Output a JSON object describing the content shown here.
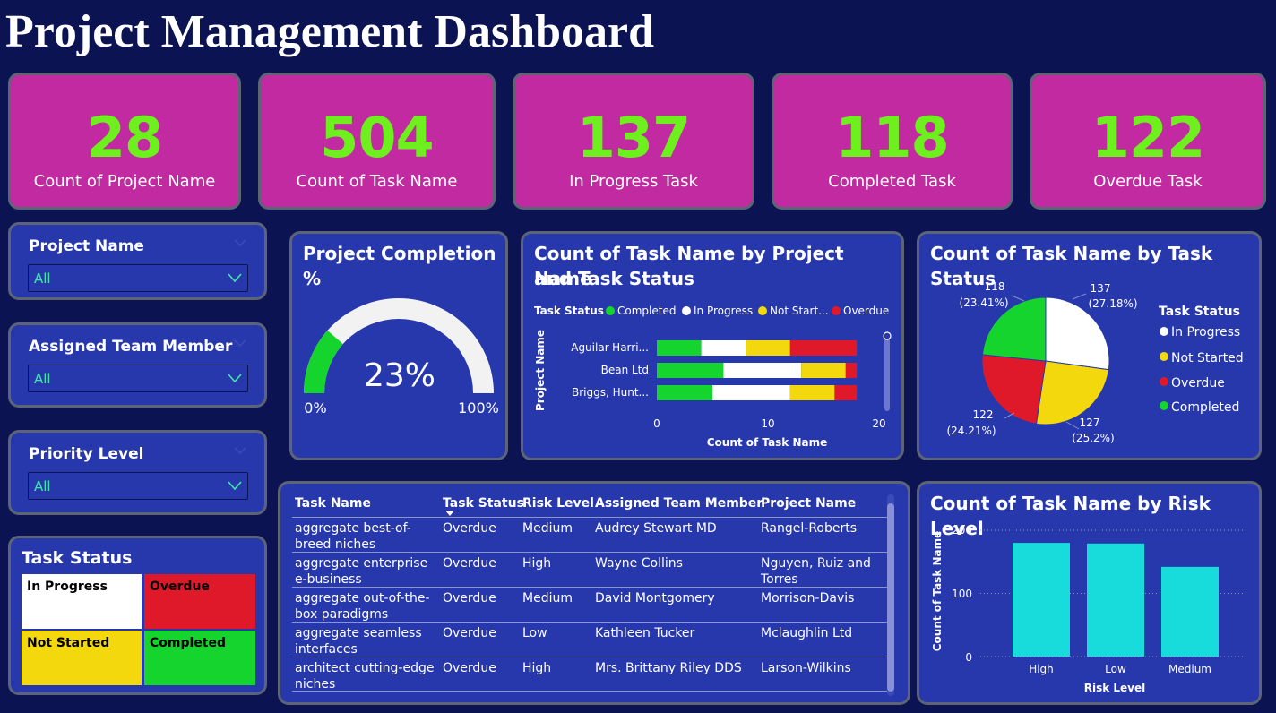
{
  "title": "Project Management Dashboard",
  "colors": {
    "background": "#0b1352",
    "card": "#2738ad",
    "kpi_card": "#c12aa0",
    "kpi_value": "#6ef01e",
    "completed": "#16d42e",
    "in_progress": "#ffffff",
    "not_started": "#f2d80c",
    "overdue": "#e0192a",
    "bar": "#18dcdc"
  },
  "kpis": [
    {
      "value": "28",
      "label": "Count of Project Name"
    },
    {
      "value": "504",
      "label": "Count of Task Name"
    },
    {
      "value": "137",
      "label": "In Progress Task"
    },
    {
      "value": "118",
      "label": "Completed Task"
    },
    {
      "value": "122",
      "label": "Overdue Task"
    }
  ],
  "slicers": [
    {
      "title": "Project Name",
      "value": "All",
      "icon": "chevron-down-icon"
    },
    {
      "title": "Assigned Team Member",
      "value": "All",
      "icon": "chevron-down-icon"
    },
    {
      "title": "Priority Level",
      "value": "All",
      "icon": "chevron-down-icon"
    }
  ],
  "task_status_legend": {
    "title": "Task Status",
    "cells": [
      "In Progress",
      "Overdue",
      "Not Started",
      "Completed"
    ]
  },
  "gauge": {
    "title": "Project Completion %",
    "value_label": "23%",
    "value_fraction": 0.23,
    "min_label": "0%",
    "max_label": "100%"
  },
  "stacked_chart": {
    "title_line1": "Count of Task Name by Project Name",
    "title_line2": "and Task Status",
    "legend_title": "Task Status",
    "legend": [
      "Completed",
      "In Progress",
      "Not Start...",
      "Overdue"
    ],
    "ylabel": "Project Name",
    "xlabel": "Count of Task Name",
    "xticks": [
      "0",
      "10",
      "20"
    ]
  },
  "pie_chart": {
    "title": "Count of Task Name by Task Status",
    "legend_title": "Task Status",
    "legend": [
      "In Progress",
      "Not Started",
      "Overdue",
      "Completed"
    ],
    "labels": [
      {
        "count": "137",
        "pct": "(27.18%)"
      },
      {
        "count": "127",
        "pct": "(25.2%)"
      },
      {
        "count": "122",
        "pct": "(24.21%)"
      },
      {
        "count": "118",
        "pct": "(23.41%)"
      }
    ]
  },
  "bar_chart": {
    "title": "Count of Task Name by Risk Level",
    "ylabel": "Count of Task Name",
    "xlabel": "Risk Level",
    "yticks": [
      "200",
      "100",
      "0"
    ]
  },
  "table": {
    "headers": [
      "Task Name",
      "Task Status",
      "Risk Level",
      "Assigned Team Member",
      "Project Name"
    ],
    "rows": [
      {
        "task_l1": "aggregate best-of-",
        "task_l2": "breed niches",
        "status": "Overdue",
        "risk": "Medium",
        "member": "Audrey Stewart MD",
        "proj_l1": "Rangel-Roberts",
        "proj_l2": ""
      },
      {
        "task_l1": "aggregate enterprise",
        "task_l2": "e-business",
        "status": "Overdue",
        "risk": "High",
        "member": "Wayne Collins",
        "proj_l1": "Nguyen, Ruiz and",
        "proj_l2": "Torres"
      },
      {
        "task_l1": "aggregate out-of-the-",
        "task_l2": "box paradigms",
        "status": "Overdue",
        "risk": "Medium",
        "member": "David Montgomery",
        "proj_l1": "Morrison-Davis",
        "proj_l2": ""
      },
      {
        "task_l1": "aggregate seamless",
        "task_l2": "interfaces",
        "status": "Overdue",
        "risk": "Low",
        "member": "Kathleen Tucker",
        "proj_l1": "Mclaughlin Ltd",
        "proj_l2": ""
      },
      {
        "task_l1": "architect cutting-edge",
        "task_l2": "niches",
        "status": "Overdue",
        "risk": "High",
        "member": "Mrs. Brittany Riley DDS",
        "proj_l1": "Larson-Wilkins",
        "proj_l2": ""
      }
    ]
  },
  "chart_data": [
    {
      "type": "bar",
      "orientation": "horizontal",
      "stacked": true,
      "title": "Count of Task Name by Project Name and Task Status",
      "categories": [
        "Aguilar-Harri...",
        "Bean Ltd",
        "Briggs, Hunt..."
      ],
      "series": [
        {
          "name": "Completed",
          "values": [
            4,
            6,
            5
          ]
        },
        {
          "name": "In Progress",
          "values": [
            4,
            7,
            7
          ]
        },
        {
          "name": "Not Start...",
          "values": [
            4,
            4,
            4
          ]
        },
        {
          "name": "Overdue",
          "values": [
            6,
            1,
            2
          ]
        }
      ],
      "xlim": [
        0,
        20
      ],
      "xlabel": "Count of Task Name",
      "ylabel": "Project Name",
      "legend_title": "Task Status",
      "legend_position": "top"
    },
    {
      "type": "pie",
      "title": "Count of Task Name by Task Status",
      "categories": [
        "In Progress",
        "Not Started",
        "Overdue",
        "Completed"
      ],
      "values": [
        137,
        127,
        122,
        118
      ],
      "percentages": [
        27.18,
        25.2,
        24.21,
        23.41
      ],
      "legend_title": "Task Status",
      "legend_position": "right"
    },
    {
      "type": "bar",
      "title": "Count of Task Name by Risk Level",
      "categories": [
        "High",
        "Low",
        "Medium"
      ],
      "values": [
        180,
        179,
        142
      ],
      "ylim": [
        0,
        200
      ],
      "xlabel": "Risk Level",
      "ylabel": "Count of Task Name",
      "grid": true
    }
  ]
}
